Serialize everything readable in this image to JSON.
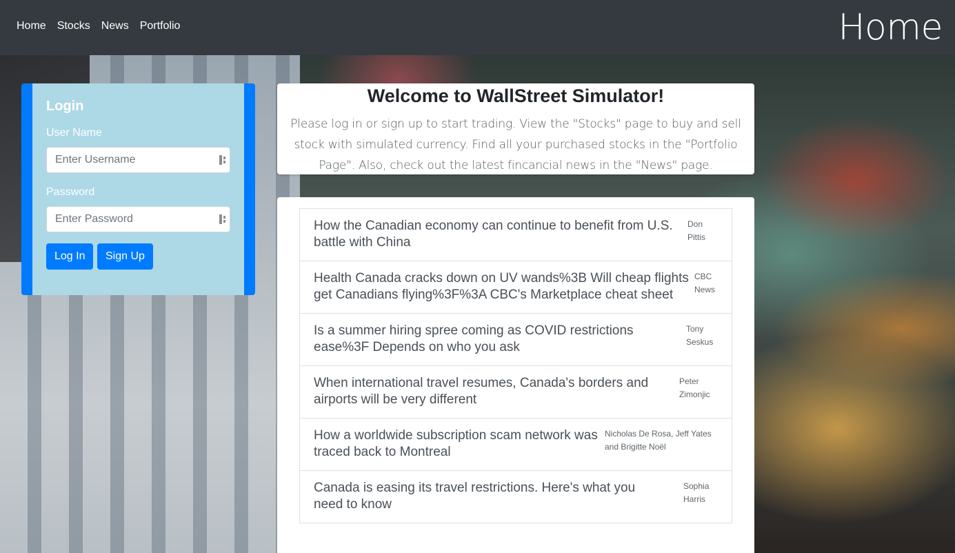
{
  "navbar": {
    "links": [
      "Home",
      "Stocks",
      "News",
      "Portfolio"
    ],
    "page_title": "Home"
  },
  "login": {
    "title": "Login",
    "username_label": "User Name",
    "username_placeholder": "Enter Username",
    "password_label": "Password",
    "password_placeholder": "Enter Password",
    "login_button": "Log In",
    "signup_button": "Sign Up"
  },
  "welcome": {
    "title": "Welcome to WallStreet Simulator!",
    "text": "Please log in or sign up to start trading. View the \"Stocks\" page to buy and sell stock with simulated currency. Find all your purchased stocks in the \"Portfolio Page\". Also, check out the latest fincancial news in the \"News\" page."
  },
  "news": [
    {
      "headline": "How the Canadian economy can continue to benefit from U.S. battle with China",
      "author": "Don Pittis"
    },
    {
      "headline": "Health Canada cracks down on UV wands%3B Will cheap flights get Canadians flying%3F%3A CBC's Marketplace cheat sheet",
      "author": "CBC News"
    },
    {
      "headline": "Is a summer hiring spree coming as COVID restrictions ease%3F Depends on who you ask",
      "author": "Tony Seskus"
    },
    {
      "headline": "When international travel resumes, Canada's borders and airports will be very different",
      "author": "Peter Zimonjic"
    },
    {
      "headline": "How a worldwide subscription scam network was traced back to Montreal",
      "author": "Nicholas De Rosa, Jeff Yates and Brigitte Noël"
    },
    {
      "headline": "Canada is easing its travel restrictions. Here's what you need to know",
      "author": "Sophia Harris"
    }
  ],
  "colors": {
    "navbar": "#343a40",
    "primary": "#007bff",
    "login_panel": "#add8e6"
  },
  "icons": {
    "input_autofill": "key-icon"
  }
}
